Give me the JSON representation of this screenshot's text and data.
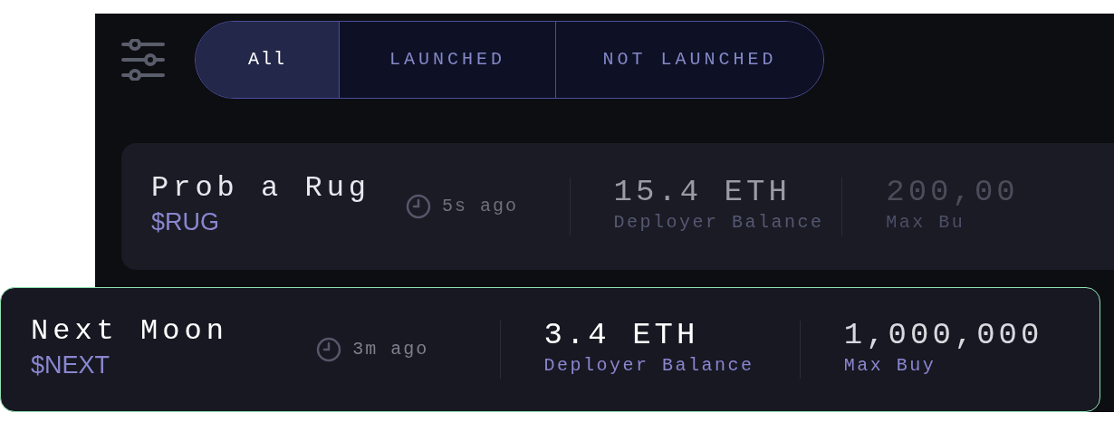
{
  "tabs": [
    {
      "label": "All",
      "selected": true
    },
    {
      "label": "LAUNCHED",
      "selected": false
    },
    {
      "label": "NOT LAUNCHED",
      "selected": false
    }
  ],
  "tokens": [
    {
      "name": "Prob a Rug",
      "ticker": "$RUG",
      "time": "5s ago",
      "selected": false,
      "stats": [
        {
          "value": "15.4 ETH",
          "label": "Deployer Balance"
        },
        {
          "value": "200,00",
          "label": "Max Bu"
        }
      ]
    },
    {
      "name": "Next Moon",
      "ticker": "$NEXT",
      "time": "3m ago",
      "selected": true,
      "stats": [
        {
          "value": "3.4 ETH",
          "label": "Deployer Balance"
        },
        {
          "value": "1,000,000",
          "label": "Max Buy"
        }
      ]
    }
  ]
}
